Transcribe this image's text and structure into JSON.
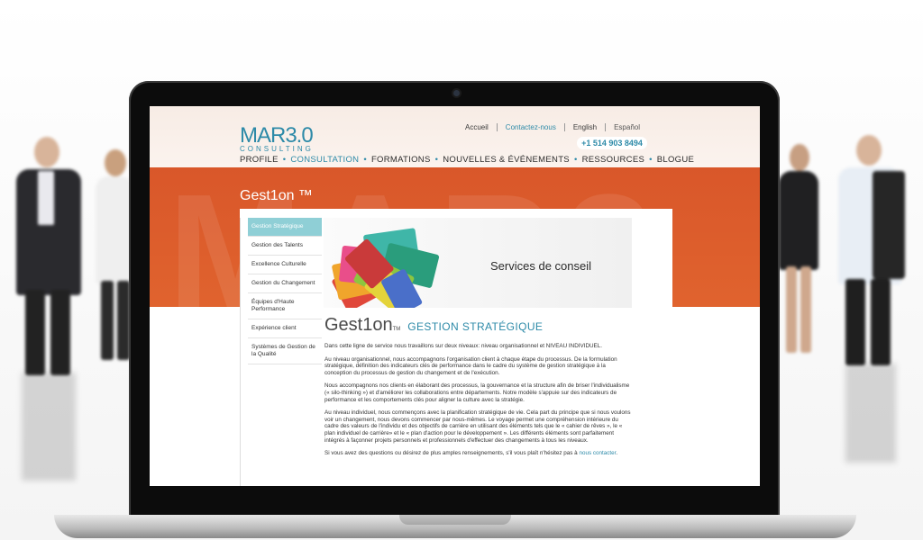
{
  "site": {
    "logo_main": "MAR3.0",
    "logo_sub": "CONSULTING",
    "phone": "+1 514 903 8494",
    "watermark": "MAR3",
    "top_links": [
      "Accueil",
      "Contactez-nous",
      "English",
      "Español"
    ],
    "nav": [
      "PROFILE",
      "CONSULTATION",
      "FORMATIONS",
      "NOUVELLES & ÉVÉNEMENTS",
      "RESSOURCES",
      "BLOGUE"
    ],
    "nav_active_index": 1,
    "page_title": "Gest1on ™"
  },
  "sidebar": {
    "items": [
      "Gestion Stratégique",
      "Gestion des Talents",
      "Excellence Culturelle",
      "Gestion du Changement",
      "Équipes d'Haute Performance",
      "Expérience client",
      "Systèmes de Gestion de la Qualité"
    ],
    "active_index": 0
  },
  "banner": {
    "text": "Services de conseil"
  },
  "section": {
    "brand": "Gest1on",
    "tm": "TM",
    "title": "GESTION STRATÉGIQUE"
  },
  "paragraphs": [
    "Dans cette ligne de service nous travaillons sur deux niveaux: niveau organisationnel et NIVEAU INDIVIDUEL.",
    "Au niveau organisationnel, nous accompagnons l'organisation client à chaque étape du processus. De la formulation stratégique, définition des indicateurs clés de performance dans le cadre du système de gestion stratégique à la conception du processus de gestion du changement et de l'exécution.",
    "Nous accompagnons nos clients en élaborant des processus, la gouvernance et la structure afin de briser l'individualisme (« silo-thinking ») et d'améliorer les collaborations entre départements. Notre modèle s'appuie sur des indicateurs de performance et les comportements clés pour aligner la culture avec la stratégie.",
    "Au niveau individuel, nous commençons avec la planification stratégique de vie. Cela part du principe que si nous voulons voir un changement, nous devons commencer par nous-mêmes. Le voyage permet une compréhension intérieure du cadre des valeurs de l'individu et des objectifs de carrière en utilisant des éléments tels que le « cahier de rêves », le « plan individuel de carrière» et le « plan d'action pour le développement ». Les différents éléments sont parfaitement intégrés à façonner projets personnels et professionnels d'effectuer des changements à tous les niveaux."
  ],
  "closing": {
    "text": "Si vous avez des questions ou désirez de plus amples renseignements, s'il vous plaît n'hésitez pas à ",
    "link": "nous contacter",
    "end": "."
  },
  "colors": {
    "accent": "#2d8aa8",
    "orange": "#d9572a",
    "sidebar_active": "#8fcfd6"
  }
}
